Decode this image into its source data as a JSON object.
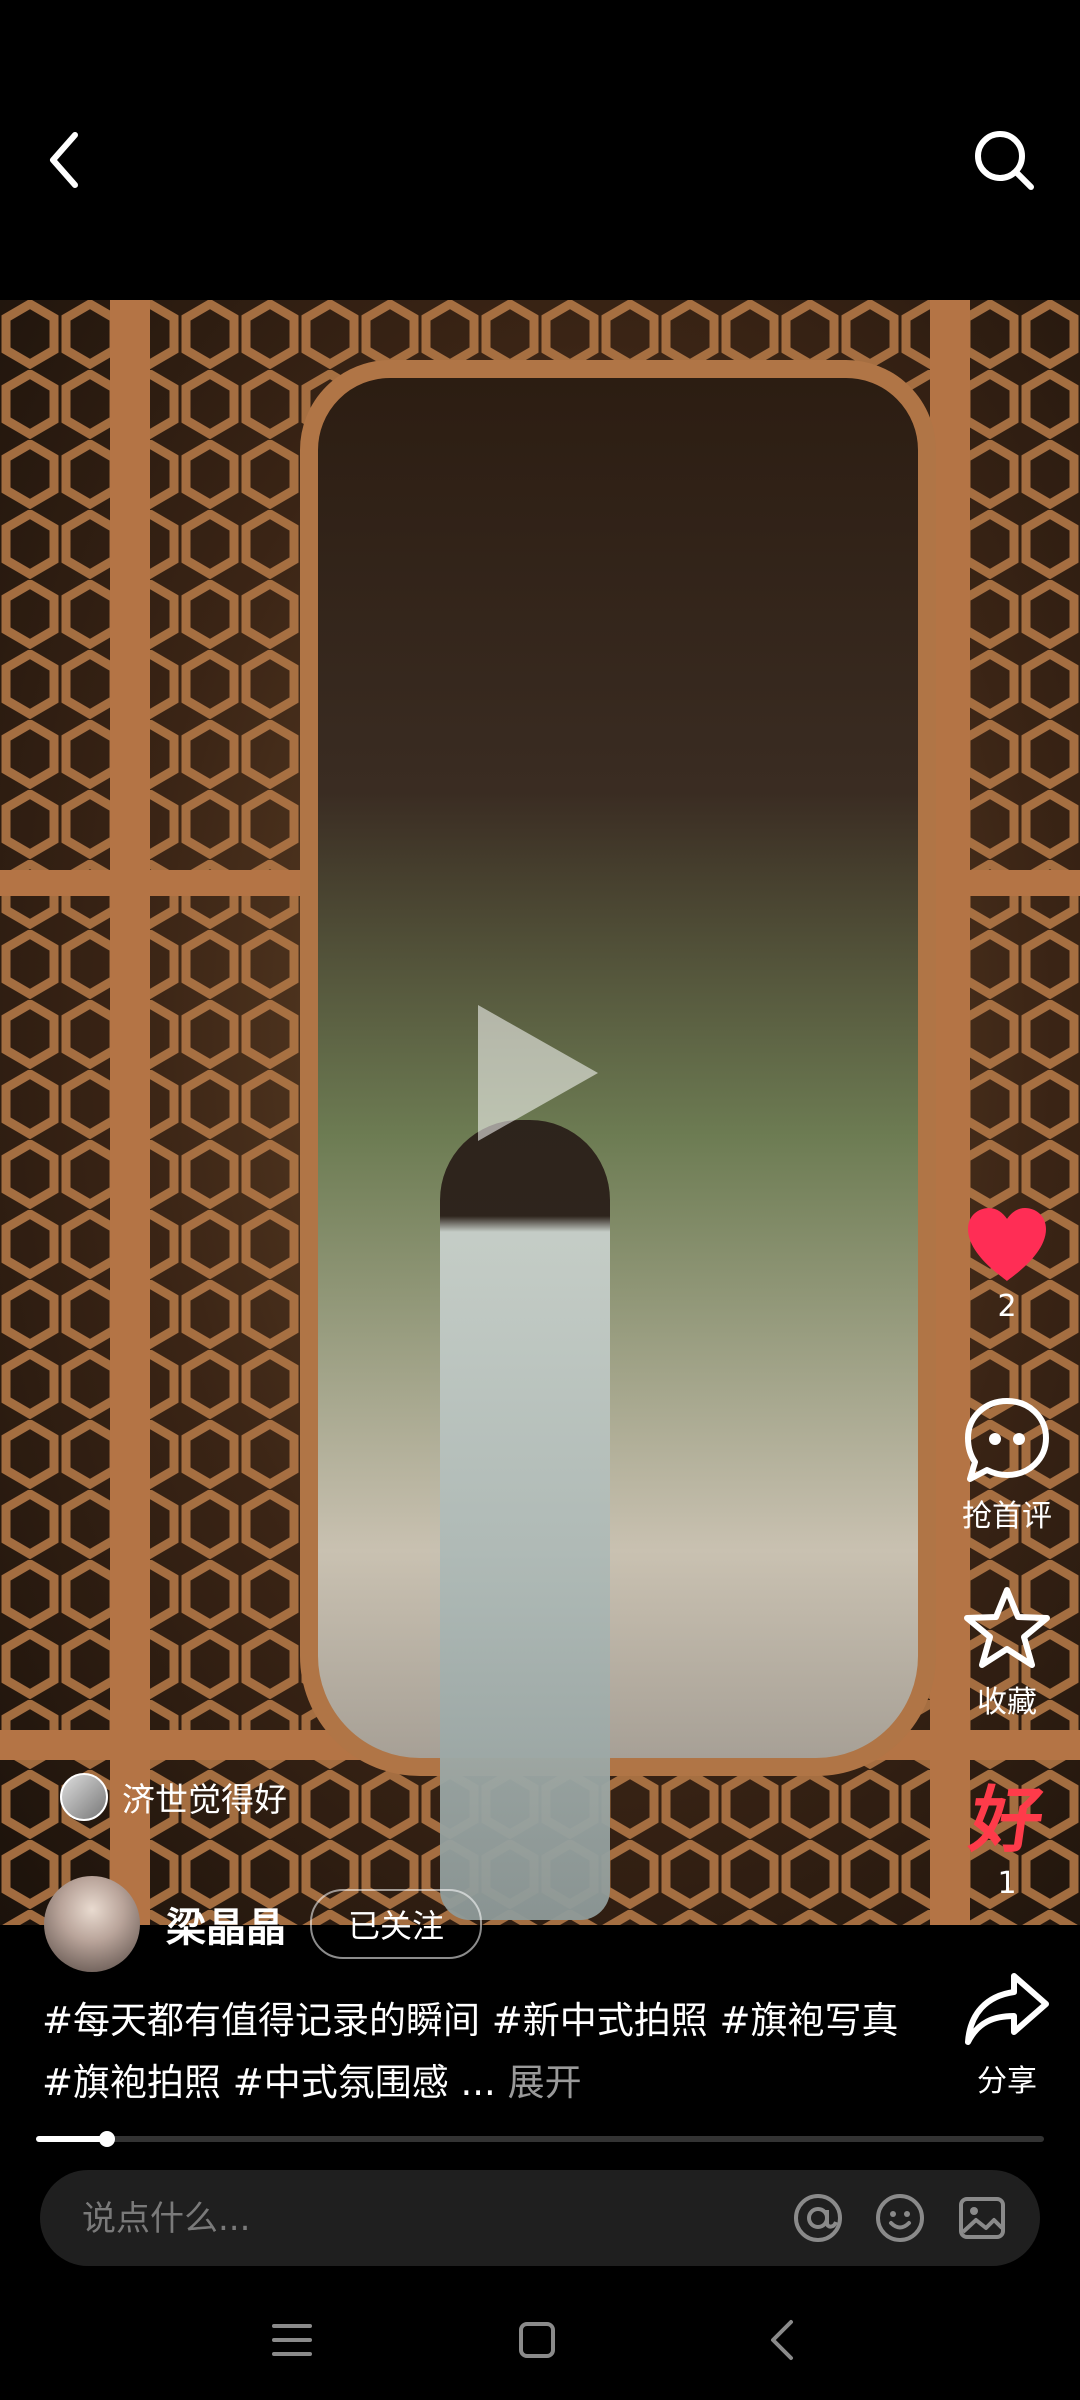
{
  "header": {
    "back_icon": "chevron-left-icon",
    "search_icon": "search-icon"
  },
  "media": {
    "play_icon": "play-icon",
    "mention": {
      "name": "济世觉得好"
    }
  },
  "rail": {
    "like": {
      "icon": "heart-icon",
      "count": "2",
      "color": "#ff2d55"
    },
    "comment": {
      "icon": "comment-icon",
      "label": "抢首评"
    },
    "favorite": {
      "icon": "star-icon",
      "label": "收藏"
    },
    "good": {
      "icon": "good-badge-icon",
      "glyph": "好",
      "count": "1",
      "color": "#ff3b4a"
    },
    "share": {
      "icon": "share-icon",
      "label": "分享"
    }
  },
  "author": {
    "name": "梁晶晶",
    "follow_label": "已关注"
  },
  "description": {
    "text": "#每天都有值得记录的瞬间 #新中式拍照 #旗袍写真 #旗袍拍照 #中式氛围感 ...",
    "more_label": "展开"
  },
  "progress": {
    "fraction": 0.07
  },
  "comment_input": {
    "placeholder": "说点什么..."
  },
  "system_nav": {
    "menu_icon": "menu-icon",
    "home_icon": "home-icon",
    "back_icon": "back-icon"
  }
}
